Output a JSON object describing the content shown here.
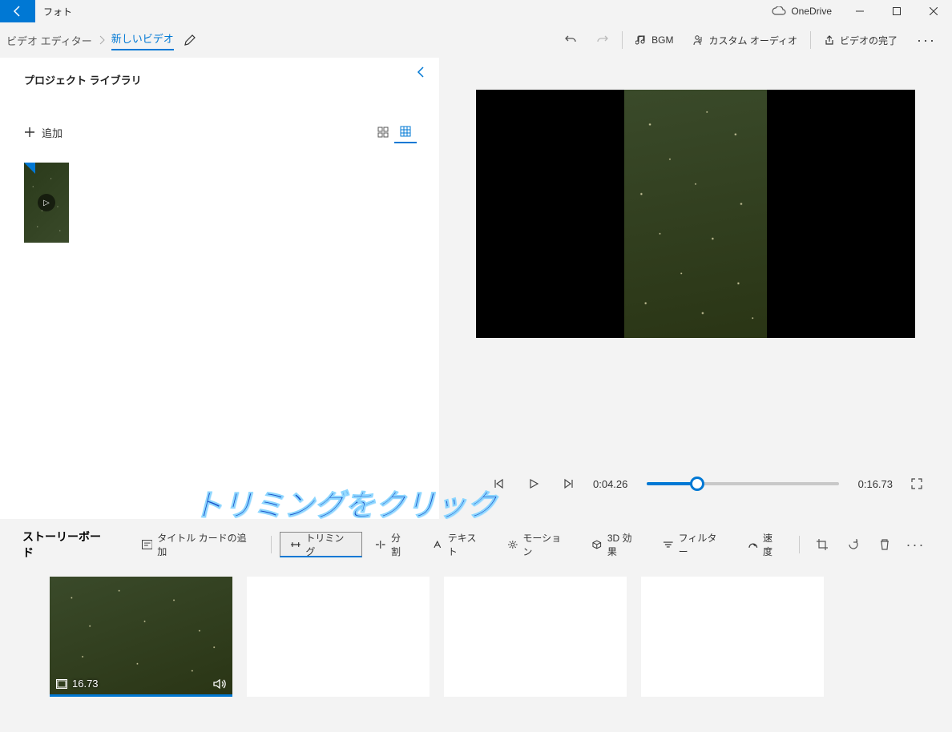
{
  "titlebar": {
    "app_name": "フォト",
    "onedrive": "OneDrive"
  },
  "breadcrumb": {
    "root": "ビデオ エディター",
    "current": "新しいビデオ"
  },
  "commands": {
    "bgm": "BGM",
    "custom_audio": "カスタム オーディオ",
    "finish": "ビデオの完了"
  },
  "library": {
    "title": "プロジェクト ライブラリ",
    "add": "追加"
  },
  "transport": {
    "current_time": "0:04.26",
    "total_time": "0:16.73",
    "progress_percent": 26
  },
  "annotation": "トリミングをクリック",
  "storyboard": {
    "title": "ストーリーボード",
    "add_title_card": "タイトル カードの追加",
    "trim": "トリミング",
    "split": "分割",
    "text": "テキスト",
    "motion": "モーション",
    "effects_3d": "3D 効果",
    "filter": "フィルター",
    "speed": "速度"
  },
  "clip": {
    "duration": "16.73"
  }
}
